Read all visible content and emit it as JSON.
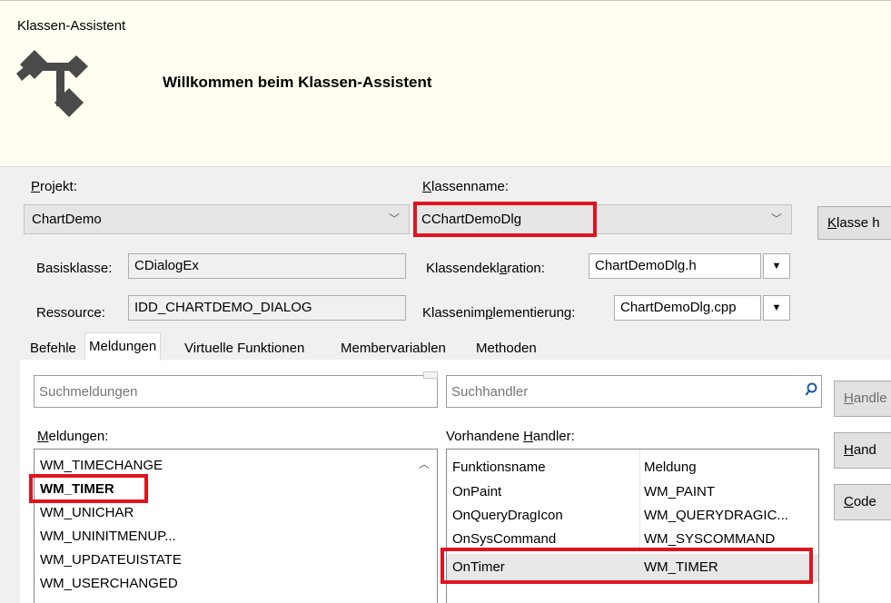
{
  "window": {
    "title": "Klassen-Assistent"
  },
  "header": {
    "heading": "Willkommen beim Klassen-Assistent"
  },
  "projekt": {
    "label_pre": "",
    "label_ul": "P",
    "label_post": "rojekt:",
    "value": "ChartDemo"
  },
  "klassenname": {
    "label_pre": "",
    "label_ul": "K",
    "label_post": "lassenname:",
    "value": "CChartDemoDlg"
  },
  "klasse_button": {
    "label_pre": "",
    "label_ul": "K",
    "label_post": "lasse h"
  },
  "basisklasse": {
    "label": "Basisklasse:",
    "value": "CDialogEx"
  },
  "ressource": {
    "label": "Ressource:",
    "value": "IDD_CHARTDEMO_DIALOG"
  },
  "klassendeklaration": {
    "label_pre": "Klassendekl",
    "label_ul": "a",
    "label_post": "ration:",
    "value": "ChartDemoDlg.h"
  },
  "klassenimplementierung": {
    "label_pre": "Klassenim",
    "label_ul": "p",
    "label_post": "lementierung:",
    "value": "ChartDemoDlg.cpp"
  },
  "tabs": [
    "Befehle",
    "Meldungen",
    "Virtuelle Funktionen",
    "Membervariablen",
    "Methoden"
  ],
  "search_messages": {
    "placeholder": "Suchmeldungen"
  },
  "search_handlers": {
    "placeholder": "Suchhandler"
  },
  "messages_label": {
    "pre": "",
    "ul": "M",
    "post": "eldungen:"
  },
  "handlers_label": {
    "pre": "Vorhandene ",
    "ul": "H",
    "post": "andler:"
  },
  "messages": [
    "WM_TIMECHANGE",
    "WM_TIMER",
    "WM_UNICHAR",
    "WM_UNINITMENUP...",
    "WM_UPDATEUISTATE",
    "WM_USERCHANGED"
  ],
  "selected_message": "WM_TIMER",
  "handlers_header": {
    "col1": "Funktionsname",
    "col2": "Meldung"
  },
  "handlers": [
    {
      "name": "OnPaint",
      "message": "WM_PAINT"
    },
    {
      "name": "OnQueryDragIcon",
      "message": "WM_QUERYDRAGIC..."
    },
    {
      "name": "OnSysCommand",
      "message": "WM_SYSCOMMAND"
    },
    {
      "name": "OnTimer",
      "message": "WM_TIMER"
    }
  ],
  "right_buttons": [
    {
      "pre": "",
      "ul": "H",
      "post": "andle"
    },
    {
      "pre": "",
      "ul": "H",
      "post": "and"
    },
    {
      "pre": "",
      "ul": "C",
      "post": "ode"
    }
  ],
  "colors": {
    "highlight": "#e0141e",
    "header_bg": "#fffef0",
    "body_bg": "#f0f0f0"
  }
}
